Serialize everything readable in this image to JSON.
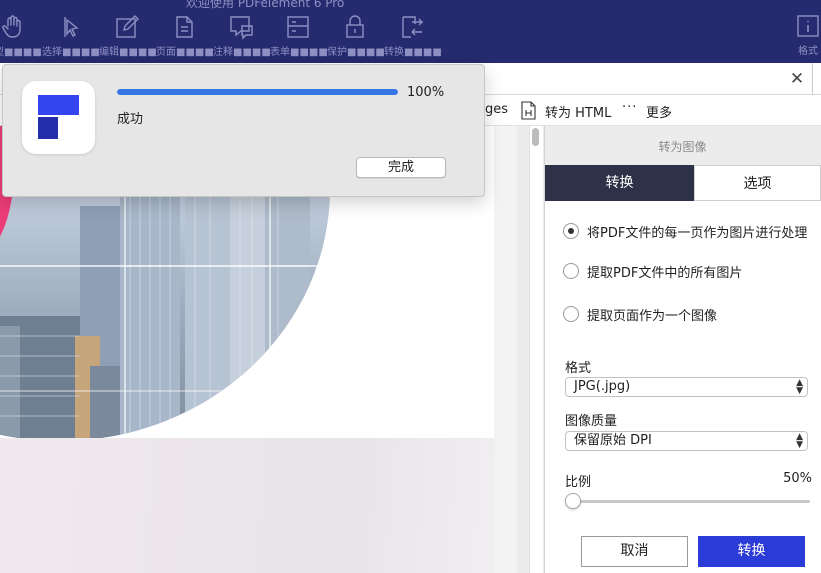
{
  "window": {
    "title": "欢迎使用 PDFelement 6 Pro"
  },
  "toolbar": {
    "tools": [
      {
        "label": "手型■■■■",
        "icon": "hand-icon"
      },
      {
        "label": "选择■■■■",
        "icon": "select-cursor-icon"
      },
      {
        "label": "编辑■■■■",
        "icon": "edit-icon"
      },
      {
        "label": "页面■■■■",
        "icon": "page-icon"
      },
      {
        "label": "注释■■■■",
        "icon": "comment-icon"
      },
      {
        "label": "表单■■■■",
        "icon": "form-icon"
      },
      {
        "label": "保护■■■■",
        "icon": "lock-icon"
      },
      {
        "label": "转换■■■■",
        "icon": "convert-icon"
      }
    ],
    "right_tool": {
      "label": "格式",
      "icon": "info-icon"
    }
  },
  "subtoolbar": {
    "images_label": "ges",
    "to_html_label": "转为 HTML",
    "more_label": "更多",
    "more_icon": "ellipsis-icon",
    "html_icon": "html-file-icon"
  },
  "tab": {
    "close_glyph": "✕"
  },
  "dialog": {
    "progress_percent": 100,
    "progress_text": "100%",
    "status": "成功",
    "done_label": "完成",
    "accent": "#3576e4"
  },
  "panel": {
    "title": "转为图像",
    "tabs": [
      {
        "label": "转换",
        "active": true
      },
      {
        "label": "选项",
        "active": false
      }
    ],
    "options": [
      {
        "label": "将PDF文件的每一页作为图片进行处理",
        "checked": true
      },
      {
        "label": "提取PDF文件中的所有图片",
        "checked": false
      },
      {
        "label": "提取页面作为一个图像",
        "checked": false
      }
    ],
    "format_label": "格式",
    "format_value": "JPG(.jpg)",
    "quality_label": "图像质量",
    "quality_value": "保留原始 DPI",
    "ratio_label": "比例",
    "ratio_value": "50%",
    "cancel_label": "取消",
    "convert_label": "转换",
    "primary_color": "#2b3bd8",
    "header_color": "#262a6e"
  }
}
